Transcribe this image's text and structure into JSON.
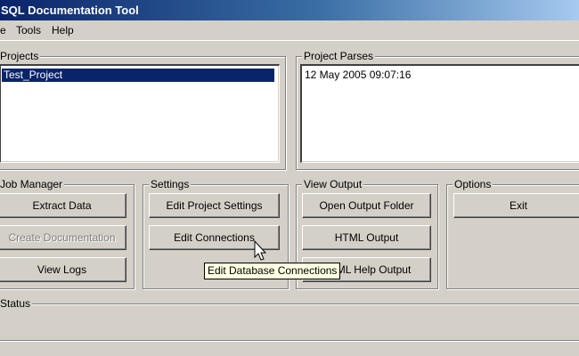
{
  "window": {
    "title": "SQL Documentation Tool"
  },
  "menu": {
    "items": [
      "e",
      "Tools",
      "Help"
    ]
  },
  "projects": {
    "label": "Projects",
    "items": [
      {
        "name": "Test_Project",
        "selected": true
      }
    ]
  },
  "project_parses": {
    "label": "Project Parses",
    "items": [
      "12 May 2005 09:07:16"
    ]
  },
  "job_manager": {
    "label": "Job Manager",
    "buttons": {
      "extract": "Extract Data",
      "create_doc": "Create Documentation",
      "view_logs": "View Logs"
    }
  },
  "settings": {
    "label": "Settings",
    "buttons": {
      "edit_project": "Edit Project Settings",
      "edit_connections": "Edit Connections"
    }
  },
  "view_output": {
    "label": "View Output",
    "buttons": {
      "open_folder": "Open Output Folder",
      "html_output": "HTML Output",
      "html_help": "HTML Help Output"
    }
  },
  "options": {
    "label": "Options",
    "buttons": {
      "exit": "Exit"
    }
  },
  "status": {
    "label": "Status"
  },
  "tooltip": {
    "text": "Edit Database Connections"
  },
  "colors": {
    "title_gradient_start": "#0a246a",
    "title_gradient_end": "#a6caf0",
    "window_face": "#d4d0c8",
    "selection": "#0a246a",
    "tooltip_bg": "#ffffe1"
  }
}
